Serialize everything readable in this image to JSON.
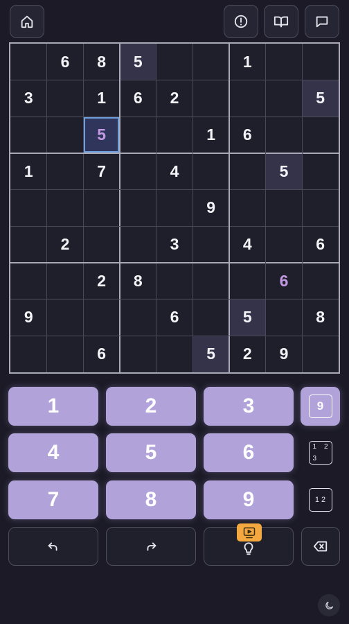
{
  "topbar": {
    "icons": [
      "home-icon",
      "alert-circle-icon",
      "book-open-icon",
      "message-square-icon"
    ]
  },
  "board": {
    "cells": [
      [
        "",
        "6",
        "8",
        "5",
        "",
        "",
        "1",
        "",
        ""
      ],
      [
        "3",
        "",
        "1",
        "6",
        "2",
        "",
        "",
        "",
        "5"
      ],
      [
        "",
        "",
        "5",
        "",
        "",
        "1",
        "6",
        "",
        ""
      ],
      [
        "1",
        "",
        "7",
        "",
        "4",
        "",
        "",
        "5",
        ""
      ],
      [
        "",
        "",
        "",
        "",
        "",
        "9",
        "",
        "",
        ""
      ],
      [
        "",
        "2",
        "",
        "",
        "3",
        "",
        "4",
        "",
        "6"
      ],
      [
        "",
        "",
        "2",
        "8",
        "",
        "",
        "",
        "6",
        ""
      ],
      [
        "9",
        "",
        "",
        "",
        "6",
        "",
        "5",
        "",
        "8"
      ],
      [
        "",
        "",
        "6",
        "",
        "",
        "5",
        "2",
        "9",
        ""
      ]
    ],
    "highlighted": [
      [
        0,
        3
      ],
      [
        1,
        8
      ],
      [
        3,
        7
      ],
      [
        7,
        6
      ],
      [
        8,
        5
      ]
    ],
    "user_entries": [
      [
        2,
        2
      ],
      [
        6,
        7
      ]
    ],
    "selected": [
      2,
      2
    ],
    "colors": {
      "given": "#f4f4f8",
      "user": "#c39ae2",
      "highlight": "#35334a",
      "selection": "#6f9fdc"
    }
  },
  "keypad": {
    "numbers": [
      "1",
      "2",
      "3",
      "4",
      "5",
      "6",
      "7",
      "8",
      "9"
    ],
    "accent": "#b1a2d9"
  },
  "modes": {
    "big_digit": "9",
    "corner_digits": [
      "1",
      "2",
      "3"
    ],
    "center_digits": "1 2",
    "active": "big"
  },
  "actions": {
    "icons": [
      "undo-icon",
      "redo-icon",
      "lightbulb-icon",
      "backspace-icon"
    ],
    "hint_badge_icon": "video-play-icon",
    "hint_badge_color": "#f3a93f"
  },
  "footer": {
    "theme_icon": "moon-icon"
  }
}
